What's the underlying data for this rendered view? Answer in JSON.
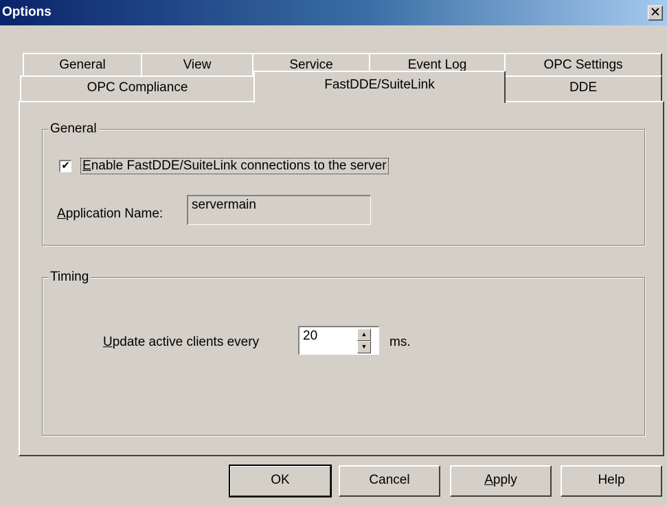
{
  "window": {
    "title": "Options",
    "close_glyph": "✕"
  },
  "tabs": {
    "row1": [
      {
        "label": "General"
      },
      {
        "label": "View"
      },
      {
        "label": "Service"
      },
      {
        "label": "Event Log"
      },
      {
        "label": "OPC Settings"
      }
    ],
    "row2": [
      {
        "label": "OPC Compliance"
      },
      {
        "label": "FastDDE/SuiteLink",
        "active": true
      },
      {
        "label": "DDE"
      }
    ]
  },
  "general_group": {
    "legend": "General",
    "enable_checkbox": {
      "checked": true,
      "check_glyph": "✔",
      "label_mnemonic": "E",
      "label_rest": "nable FastDDE/SuiteLink connections to the server"
    },
    "app_name": {
      "label_mnemonic": "A",
      "label_rest": "pplication Name:",
      "value": "servermain"
    }
  },
  "timing_group": {
    "legend": "Timing",
    "update": {
      "label_mnemonic": "U",
      "label_rest": "pdate active clients every",
      "value": "20",
      "unit": "ms.",
      "up_glyph": "▲",
      "down_glyph": "▼"
    }
  },
  "buttons": {
    "ok": "OK",
    "cancel": "Cancel",
    "apply_mnemonic": "A",
    "apply_rest": "pply",
    "help": "Help"
  }
}
